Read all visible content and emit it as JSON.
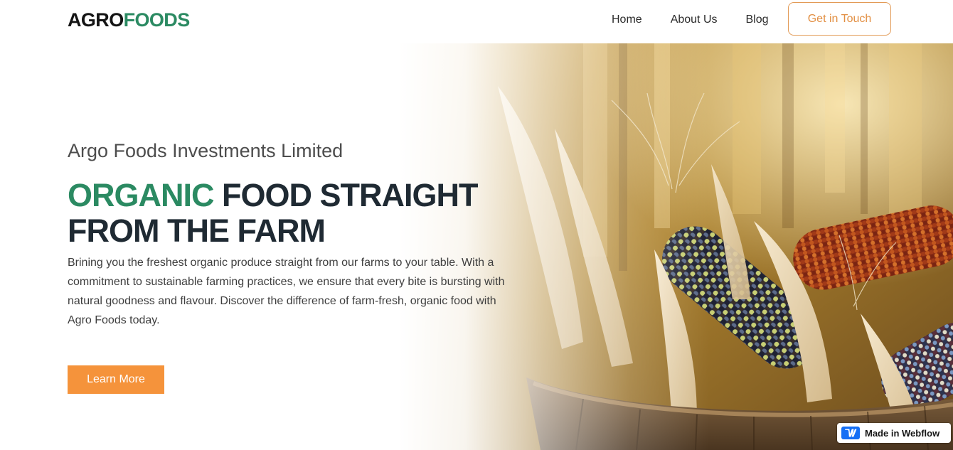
{
  "brand": {
    "logo_part1": "AGRO",
    "logo_part2": "FOODS"
  },
  "nav": {
    "items": [
      {
        "label": "Home"
      },
      {
        "label": "About Us"
      },
      {
        "label": "Blog"
      }
    ],
    "cta_label": "Get in Touch"
  },
  "hero": {
    "eyebrow": "Argo Foods Investments Limited",
    "title_accent": "ORGANIC",
    "title_rest": " FOOD STRAIGHT FROM THE FARM",
    "description": "Brining you the freshest organic produce straight from our farms to your table. With a commitment to sustainable farming practices, we ensure that every bite is bursting with natural goodness and flavour. Discover the difference of farm-fresh, organic food with Agro Foods today.",
    "button_label": "Learn More",
    "image_subject": "corn-basket-image"
  },
  "badge": {
    "label": "Made in Webflow",
    "icon": "webflow-icon"
  },
  "colors": {
    "brand_green": "#2b8a62",
    "accent_orange": "#f5933b",
    "cta_border": "#e29a56",
    "heading_dark": "#1f2a33",
    "webflow_blue": "#146ef5"
  }
}
